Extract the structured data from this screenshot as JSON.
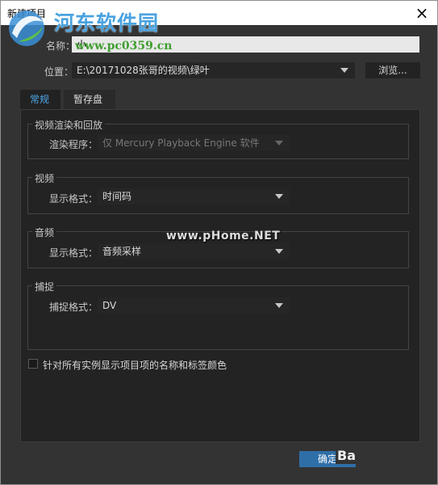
{
  "window": {
    "title": "新建项目",
    "close_symbol": "×"
  },
  "watermark": {
    "site_name": "河东软件园",
    "url": "www.pc0359.cn",
    "phome": "www.pHome.NET",
    "partial": "Ba"
  },
  "project": {
    "name_label": "名称：",
    "name_value": "小",
    "location_label": "位置：",
    "location_value": "E:\\20171028张哥的视频\\绿叶",
    "browse_label": "浏览..."
  },
  "tabs": [
    {
      "label": "常规",
      "active": true
    },
    {
      "label": "暂存盘",
      "active": false
    }
  ],
  "general": {
    "video_render_group": "视频渲染和回放",
    "renderer_label": "渲染程序：",
    "renderer_value": "仅 Mercury Playback Engine 软件",
    "video_group": "视频",
    "video_format_label": "显示格式：",
    "video_format_value": "时间码",
    "audio_group": "音频",
    "audio_format_label": "显示格式：",
    "audio_format_value": "音频采样",
    "capture_group": "捕捉",
    "capture_format_label": "捕捉格式：",
    "capture_format_value": "DV",
    "checkbox_label": "针对所有实例显示项目项的名称和标签颜色"
  },
  "footer": {
    "ok_label": "确定"
  },
  "colors": {
    "accent": "#4ea6ea",
    "ok_button": "#2f6fa8",
    "background": "#333333"
  }
}
